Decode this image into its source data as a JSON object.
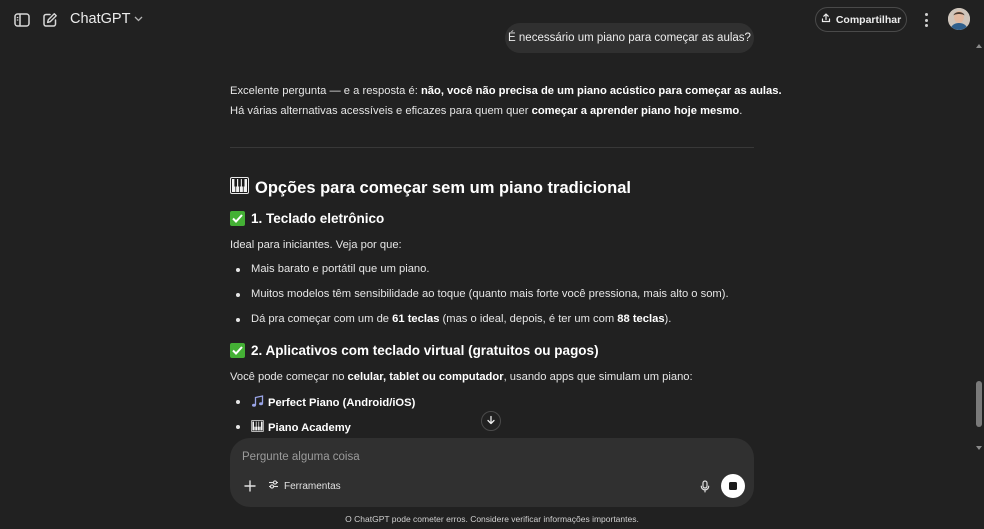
{
  "header": {
    "brand": "ChatGPT",
    "share_label": "Compartilhar",
    "icons": {
      "sidebar_toggle": "sidebar-toggle-icon",
      "new_chat": "new-chat-icon",
      "chevron": "chevron-down-icon",
      "share": "share-upload-icon",
      "more": "more-vertical-icon"
    }
  },
  "user_message": "É necessário um piano para começar as aulas?",
  "answer": {
    "intro_1_pre": "Excelente pergunta — e a resposta é: ",
    "intro_1_bold": "não, você não precisa de um piano acústico para começar as aulas.",
    "intro_2_pre": "Há várias alternativas acessíveis e eficazes para quem quer ",
    "intro_2_bold": "começar a aprender piano hoje mesmo",
    "intro_2_post": ".",
    "section_title": "Opções para começar sem um piano tradicional",
    "sub1_title": "1. Teclado eletrônico",
    "sub1_lead": "Ideal para iniciantes. Veja por que:",
    "sub1_items": {
      "i1": "Mais barato e portátil que um piano.",
      "i2": "Muitos modelos têm sensibilidade ao toque (quanto mais forte você pressiona, mais alto o som).",
      "i3_a": "Dá pra começar com um de ",
      "i3_b": "61 teclas",
      "i3_c": " (mas o ideal, depois, é ter um com ",
      "i3_d": "88 teclas",
      "i3_e": ")."
    },
    "sub2_title": "2. Aplicativos com teclado virtual (gratuitos ou pagos)",
    "sub2_lead_pre": "Você pode começar no ",
    "sub2_lead_bold": "celular, tablet ou computador",
    "sub2_lead_post": ", usando apps que simulam um piano:",
    "sub2_items": {
      "a1": "Perfect Piano (Android/iOS)",
      "a2": "Piano Academy"
    }
  },
  "composer": {
    "placeholder": "Pergunte alguma coisa",
    "tools_label": "Ferramentas"
  },
  "footer_note": "O ChatGPT pode cometer erros. Considere verificar informações importantes.",
  "colors": {
    "background": "#212121",
    "bubble": "#303030",
    "check_green": "#44b035"
  }
}
